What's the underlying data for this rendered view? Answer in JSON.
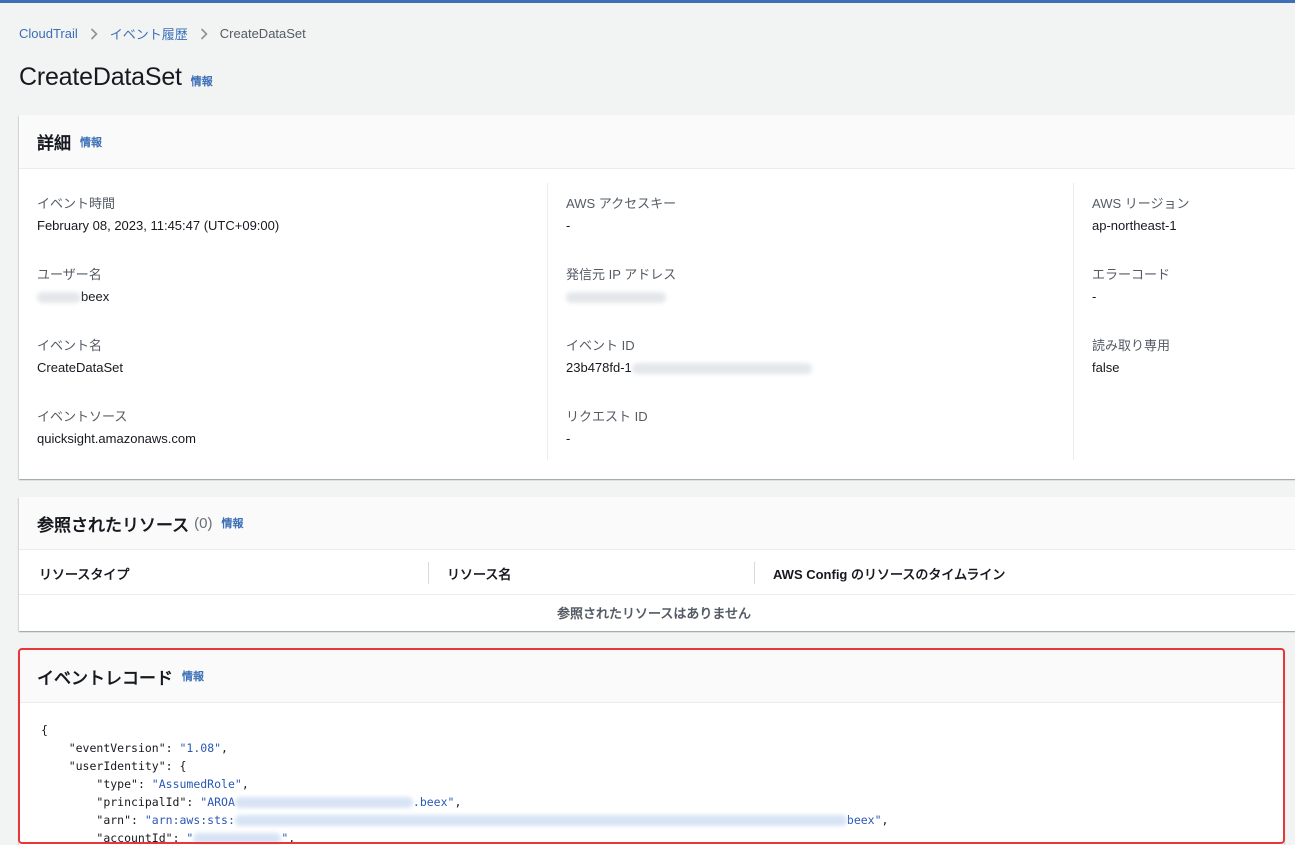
{
  "breadcrumb": {
    "items": [
      "CloudTrail",
      "イベント履歴"
    ],
    "current": "CreateDataSet"
  },
  "page": {
    "title": "CreateDataSet",
    "info": "情報"
  },
  "details": {
    "title": "詳細",
    "info": "情報",
    "col1": [
      {
        "label": "イベント時間",
        "value": "February 08, 2023, 11:45:47 (UTC+09:00)"
      },
      {
        "label": "ユーザー名",
        "value": "beex"
      },
      {
        "label": "イベント名",
        "value": "CreateDataSet"
      },
      {
        "label": "イベントソース",
        "value": "quicksight.amazonaws.com"
      }
    ],
    "col2": [
      {
        "label": "AWS アクセスキー",
        "value": "-"
      },
      {
        "label": "発信元 IP アドレス",
        "value": ""
      },
      {
        "label": "イベント ID",
        "value": "23b478fd-1"
      },
      {
        "label": "リクエスト ID",
        "value": "-"
      }
    ],
    "col3": [
      {
        "label": "AWS リージョン",
        "value": "ap-northeast-1"
      },
      {
        "label": "エラーコード",
        "value": "-"
      },
      {
        "label": "読み取り専用",
        "value": "false"
      }
    ]
  },
  "resources": {
    "title": "参照されたリソース",
    "count": "(0)",
    "info": "情報",
    "columns": [
      "リソースタイプ",
      "リソース名",
      "AWS Config のリソースのタイムライン"
    ],
    "empty": "参照されたリソースはありません"
  },
  "record": {
    "title": "イベントレコード",
    "info": "情報",
    "lines": {
      "l1": "{",
      "l2_key": "\"eventVersion\"",
      "l2_val": "\"1.08\"",
      "l3_key": "\"userIdentity\"",
      "l4_key": "\"type\"",
      "l4_val": "\"AssumedRole\"",
      "l5_key": "\"principalId\"",
      "l5_pre": "\"AROA",
      "l5_post": ".beex\"",
      "l6_key": "\"arn\"",
      "l6_pre": "\"arn:aws:sts:",
      "l6_post": "beex\"",
      "l7_key": "\"accountId\"",
      "l7_pre": "\""
    }
  }
}
